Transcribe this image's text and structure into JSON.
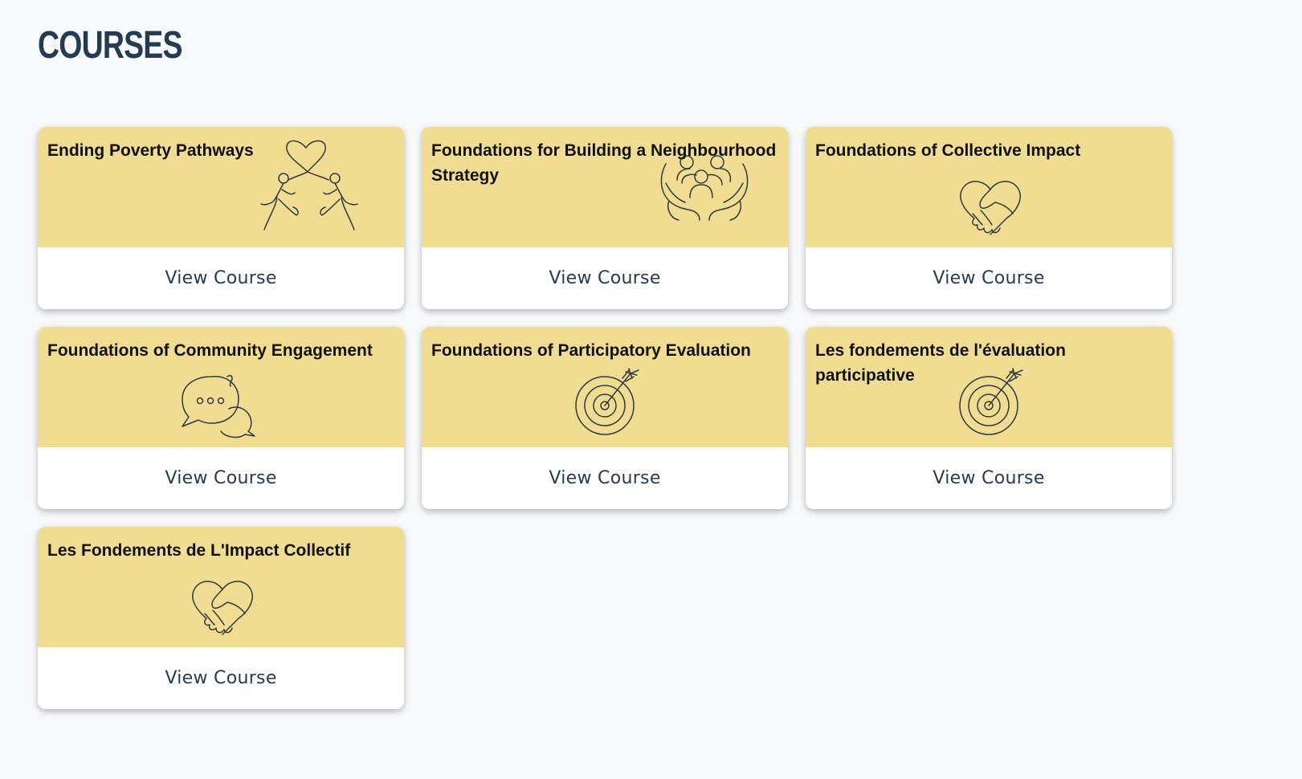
{
  "page": {
    "title": "COURSES"
  },
  "colors": {
    "background": "#f8f9fa",
    "card_header": "#f0dd91",
    "title_text": "#243b53",
    "card_title_text": "#111111",
    "icon_stroke": "#2f3a40"
  },
  "courses": [
    {
      "title": "Ending Poverty Pathways",
      "action_label": "View Course",
      "icon": "dancing-people-heart-icon"
    },
    {
      "title": "Foundations for Building a Neighbourhood Strategy",
      "action_label": "View Course",
      "icon": "hands-holding-people-icon"
    },
    {
      "title": "Foundations of Collective Impact",
      "action_label": "View Course",
      "icon": "handshake-heart-icon"
    },
    {
      "title": "Foundations of Community Engagement",
      "action_label": "View Course",
      "icon": "chat-bubbles-icon"
    },
    {
      "title": "Foundations of Participatory Evaluation",
      "action_label": "View Course",
      "icon": "target-arrow-icon"
    },
    {
      "title": "Les fondements de l'évaluation participative",
      "action_label": "View Course",
      "icon": "target-arrow-icon"
    },
    {
      "title": "Les Fondements de L'Impact Collectif",
      "action_label": "View Course",
      "icon": "handshake-heart-icon"
    }
  ]
}
